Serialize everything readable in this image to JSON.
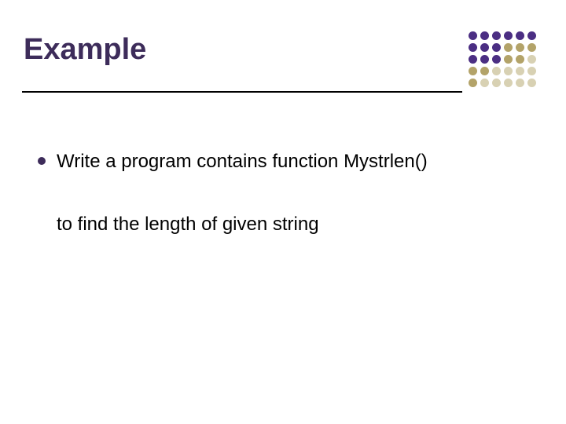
{
  "colors": {
    "title": "#3d2c5a",
    "bullet": "#3d2c5a",
    "dot_dark": "#4b2e83",
    "dot_medium": "#b3a369",
    "dot_light": "#d8d1b3"
  },
  "title": "Example",
  "bullets": [
    {
      "text": "Write a program contains function Mystrlen()",
      "continuation": "to find the length of given string"
    }
  ]
}
